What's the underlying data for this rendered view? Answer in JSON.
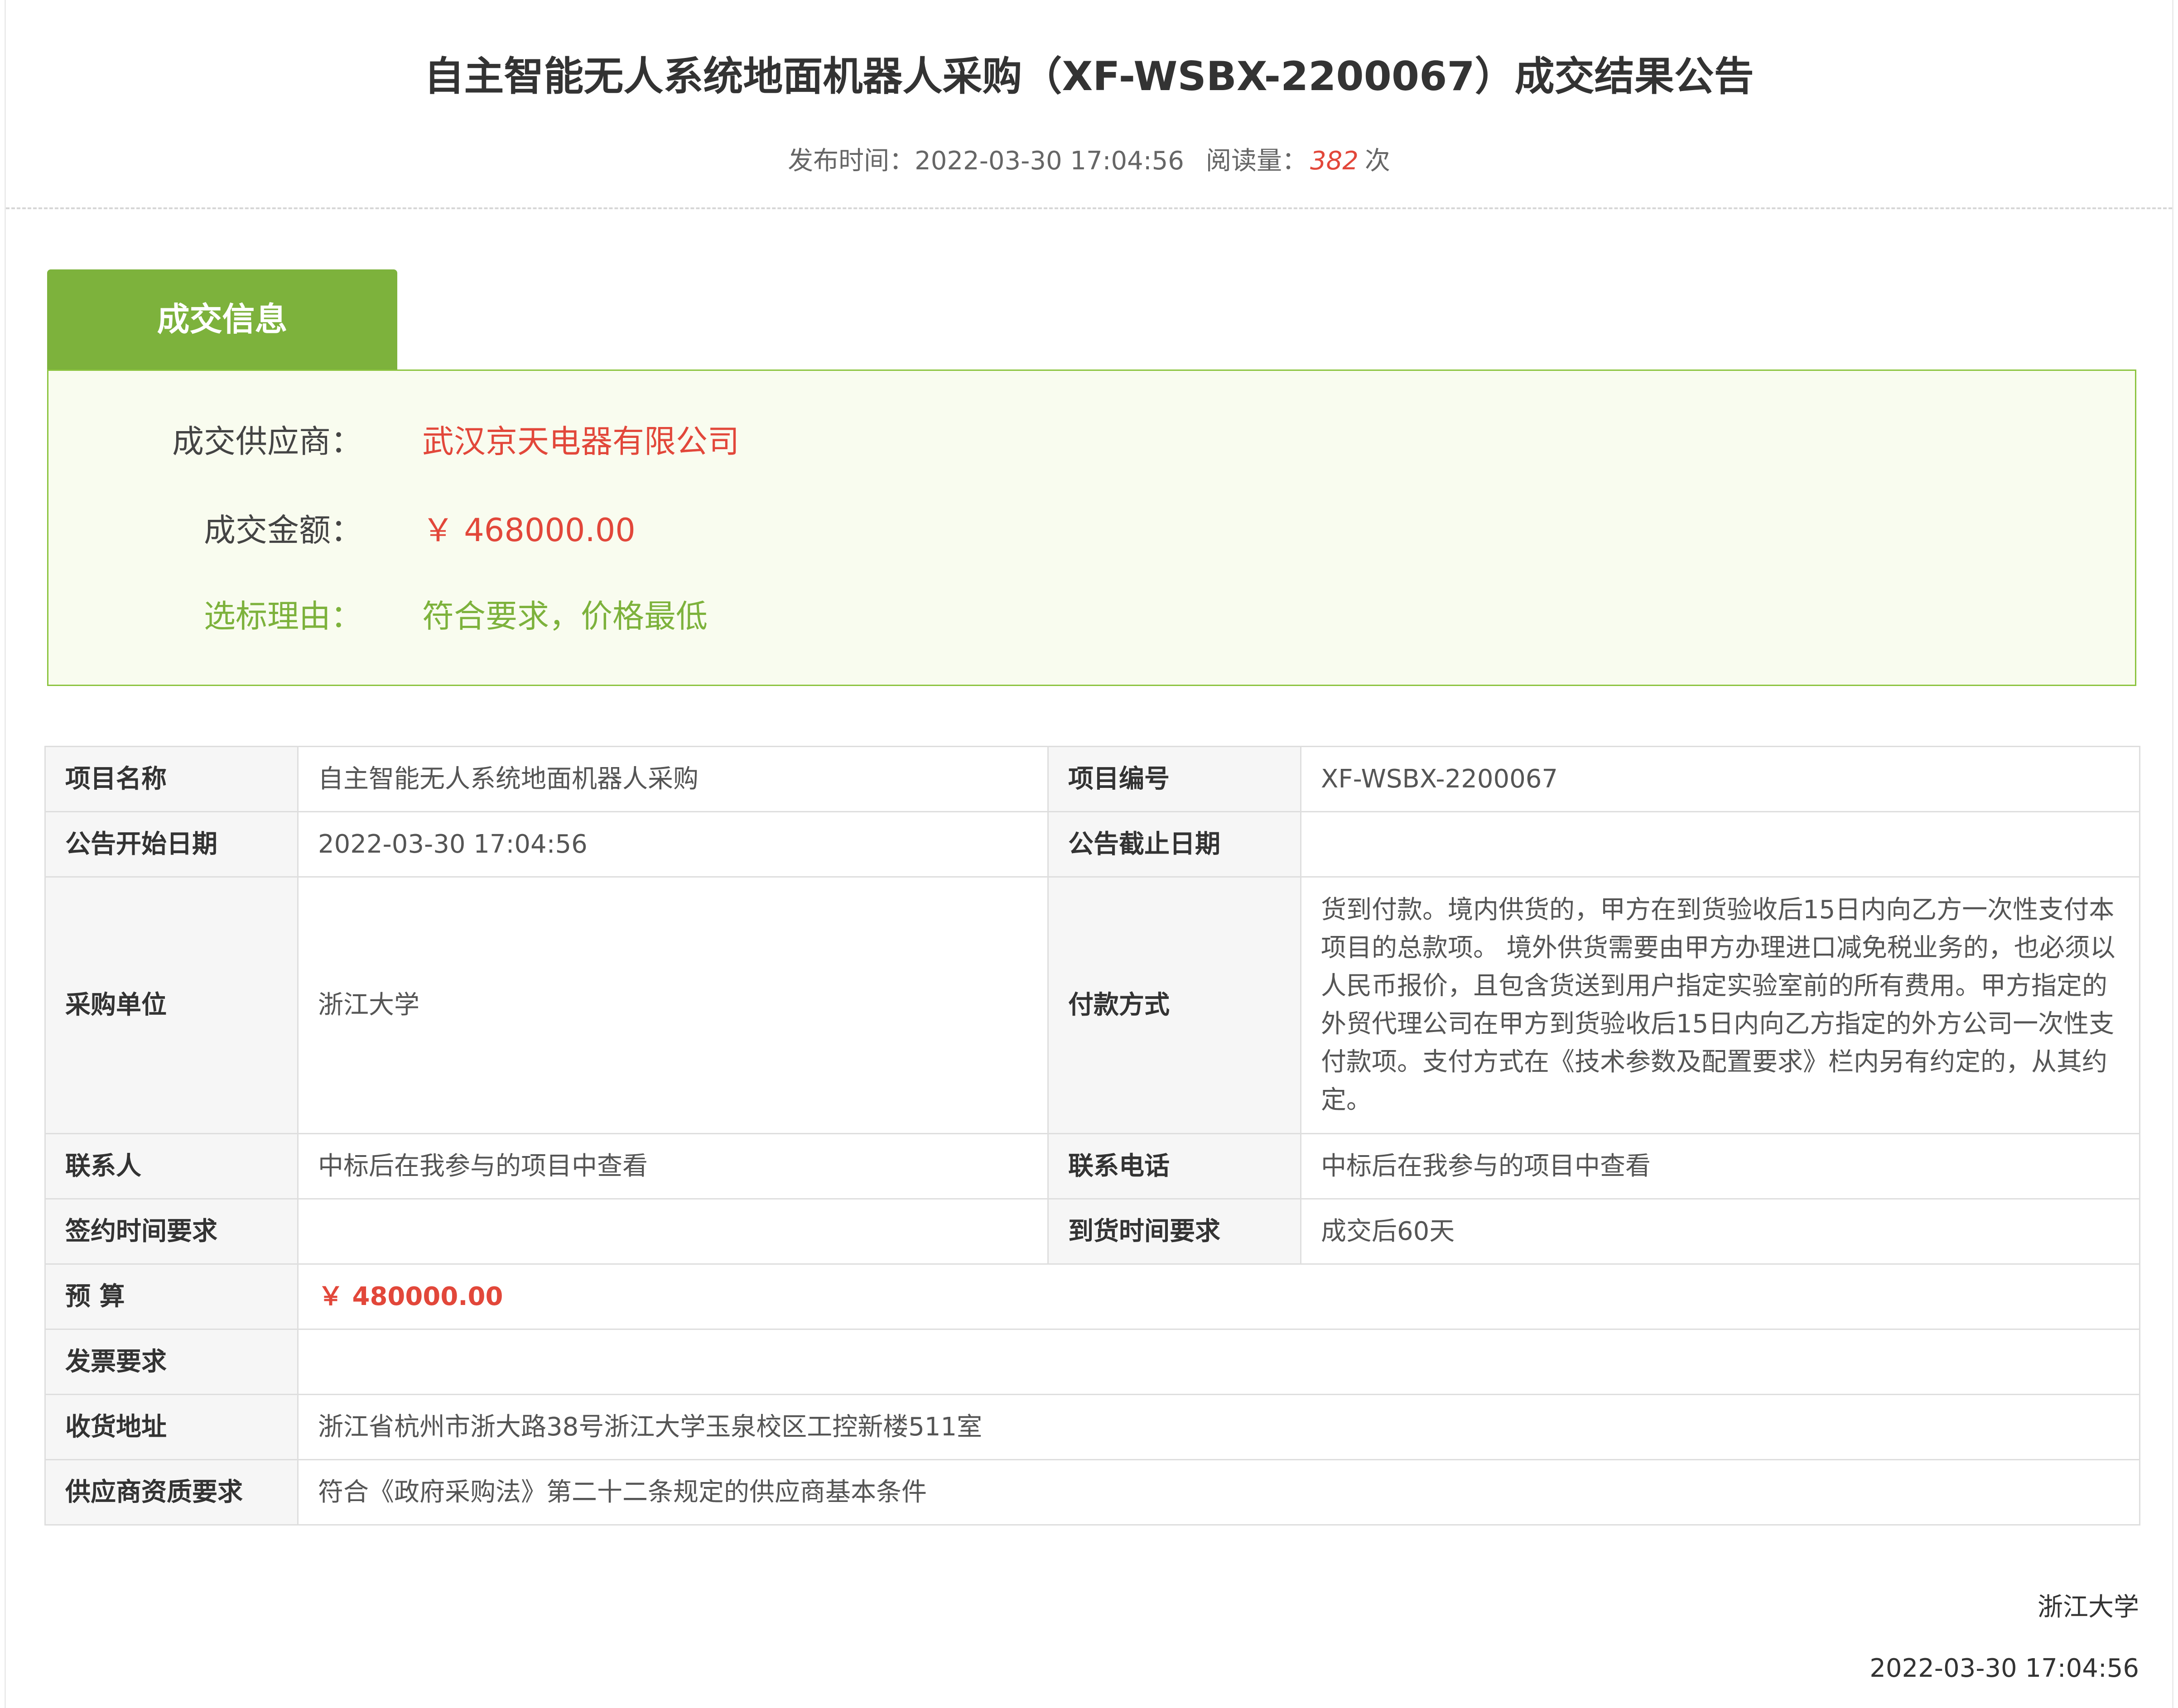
{
  "colors": {
    "accent_green": "#7db23c",
    "highlight_red": "#e2473a",
    "info_bg": "#f9fcef",
    "info_border": "#8cc43f"
  },
  "announcement": {
    "title": "自主智能无人系统地面机器人采购（XF-WSBX-2200067）成交结果公告",
    "publish_label": "发布时间：",
    "publish_time": "2022-03-30 17:04:56",
    "views_label": "阅读量：",
    "views_count": "382",
    "views_unit": "次"
  },
  "deal_info": {
    "tab_label": "成交信息",
    "supplier_label": "成交供应商：",
    "supplier_value": "武汉京天电器有限公司",
    "amount_label": "成交金额：",
    "amount_value": "￥ 468000.00",
    "reason_label": "选标理由：",
    "reason_value": "符合要求，价格最低"
  },
  "details": {
    "project_name": {
      "label": "项目名称",
      "value": "自主智能无人系统地面机器人采购"
    },
    "project_no": {
      "label": "项目编号",
      "value": "XF-WSBX-2200067"
    },
    "start_date": {
      "label": "公告开始日期",
      "value": "2022-03-30 17:04:56"
    },
    "end_date": {
      "label": "公告截止日期",
      "value": ""
    },
    "purchaser": {
      "label": "采购单位",
      "value": "浙江大学"
    },
    "payment": {
      "label": "付款方式",
      "value": "货到付款。境内供货的，甲方在到货验收后15日内向乙方一次性支付本项目的总款项。 境外供货需要由甲方办理进口减免税业务的，也必须以人民币报价，且包含货送到用户指定实验室前的所有费用。甲方指定的外贸代理公司在甲方到货验收后15日内向乙方指定的外方公司一次性支付款项。支付方式在《技术参数及配置要求》栏内另有约定的，从其约定。"
    },
    "contact": {
      "label": "联系人",
      "value": "中标后在我参与的项目中查看"
    },
    "phone": {
      "label": "联系电话",
      "value": "中标后在我参与的项目中查看"
    },
    "sign_time": {
      "label": "签约时间要求",
      "value": ""
    },
    "delivery_time": {
      "label": "到货时间要求",
      "value": "成交后60天"
    },
    "budget": {
      "label": "预 算",
      "value": "￥ 480000.00"
    },
    "invoice": {
      "label": "发票要求",
      "value": ""
    },
    "address": {
      "label": "收货地址",
      "value": "浙江省杭州市浙大路38号浙江大学玉泉校区工控新楼511室"
    },
    "qualification": {
      "label": "供应商资质要求",
      "value": "符合《政府采购法》第二十二条规定的供应商基本条件"
    }
  },
  "footer": {
    "org": "浙江大学",
    "date": "2022-03-30 17:04:56"
  }
}
